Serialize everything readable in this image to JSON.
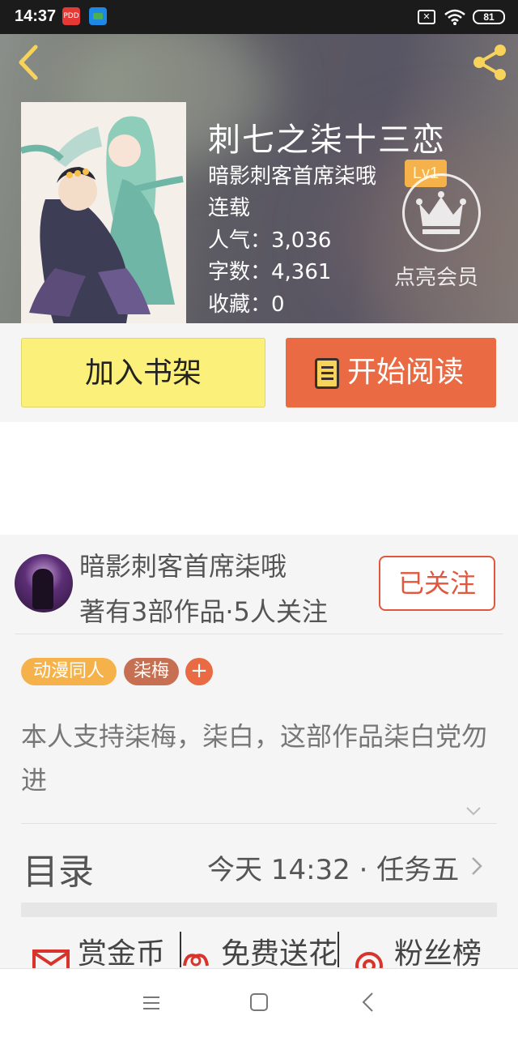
{
  "status_bar": {
    "time": "14:37",
    "app1_label": "PDD",
    "battery": "81"
  },
  "book": {
    "title": "刺七之柒十三恋",
    "author": "暗影刺客首席柒哦",
    "author_level": "Lv1",
    "status": "连载",
    "popularity": "人气：3,036",
    "word_count": "字数：4,361",
    "favorites": "收藏：0"
  },
  "vip": {
    "label": "点亮会员"
  },
  "actions": {
    "add_shelf": "加入书架",
    "start_reading": "开始阅读"
  },
  "author_card": {
    "name": "暗影刺客首席柒哦",
    "stats": "著有3部作品·5人关注",
    "follow_label": "已关注"
  },
  "tags": {
    "tag1": "动漫同人",
    "tag2": "柒梅",
    "add": "+"
  },
  "description": "本人支持柒梅，柒白，这部作品柒白党勿进",
  "toc": {
    "title": "目录",
    "latest": "今天 14:32 · 任务五"
  },
  "rewards": {
    "coins": "赏金币",
    "flowers": "免费送花",
    "fans": "粉丝榜"
  },
  "colors": {
    "accent_orange": "#e96a43",
    "shelf_yellow": "#fbf07a",
    "tag_yellow": "#f6b24a",
    "tag_brown": "#c76f52",
    "follow_red": "#e0573d"
  },
  "icons": {
    "back": "chevron-left-icon",
    "share": "share-icon",
    "crown": "crown-icon",
    "read": "book-icon",
    "coins": "envelope-icon",
    "flowers": "flower-icon",
    "fans": "target-icon"
  }
}
